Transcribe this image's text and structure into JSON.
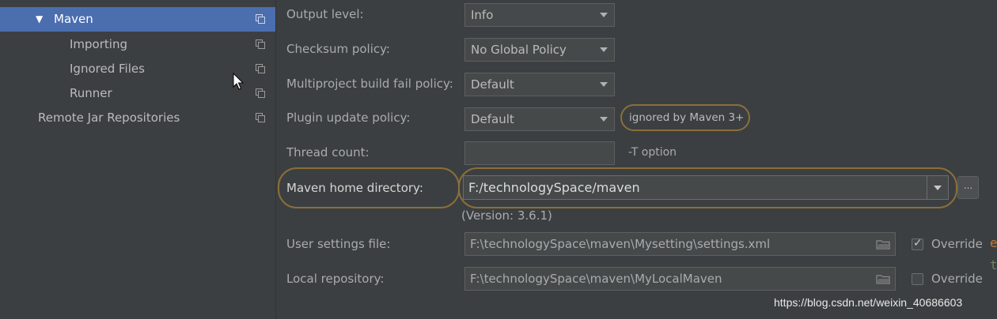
{
  "sidebar": {
    "items": [
      {
        "label": "Maven",
        "selected": true,
        "expanded": true
      },
      {
        "label": "Importing"
      },
      {
        "label": "Ignored Files"
      },
      {
        "label": "Runner"
      },
      {
        "label": "Remote Jar Repositories"
      }
    ]
  },
  "settings": {
    "output_level": {
      "label": "Output level:",
      "value": "Info"
    },
    "checksum_policy": {
      "label": "Checksum policy:",
      "value": "No Global Policy"
    },
    "fail_policy": {
      "label": "Multiproject build fail policy:",
      "value": "Default"
    },
    "plugin_update_policy": {
      "label": "Plugin update policy:",
      "value": "Default",
      "note": "ignored by Maven 3+"
    },
    "thread_count": {
      "label": "Thread count:",
      "value": "",
      "hint": "-T option"
    },
    "maven_home": {
      "label": "Maven home directory:",
      "value": "F:/technologySpace/maven",
      "version": "(Version: 3.6.1)",
      "browse_label": "..."
    },
    "user_settings": {
      "label": "User settings file:",
      "value": "F:\\technologySpace\\maven\\Mysetting\\settings.xml",
      "override_label": "Override",
      "override_checked": true
    },
    "local_repo": {
      "label": "Local repository:",
      "value": "F:\\technologySpace\\maven\\MyLocalMaven",
      "override_label": "Override",
      "override_checked": false
    }
  },
  "watermark": "https://blog.csdn.net/weixin_40686603",
  "colors": {
    "selection": "#4b6eaf",
    "highlight": "#8a6f3a",
    "background": "#3c3f41"
  }
}
